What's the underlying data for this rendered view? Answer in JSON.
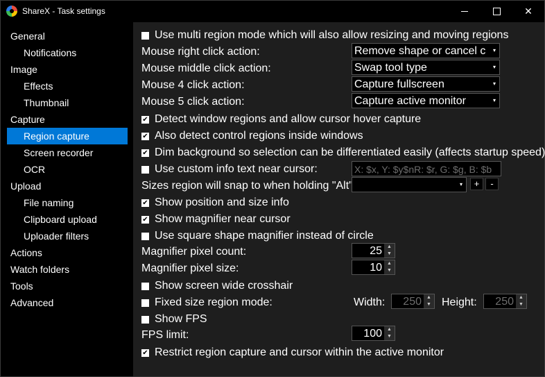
{
  "window": {
    "title": "ShareX - Task settings"
  },
  "sidebar": {
    "items": [
      {
        "label": "General"
      },
      {
        "label": "Notifications"
      },
      {
        "label": "Image"
      },
      {
        "label": "Effects"
      },
      {
        "label": "Thumbnail"
      },
      {
        "label": "Capture"
      },
      {
        "label": "Region capture"
      },
      {
        "label": "Screen recorder"
      },
      {
        "label": "OCR"
      },
      {
        "label": "Upload"
      },
      {
        "label": "File naming"
      },
      {
        "label": "Clipboard upload"
      },
      {
        "label": "Uploader filters"
      },
      {
        "label": "Actions"
      },
      {
        "label": "Watch folders"
      },
      {
        "label": "Tools"
      },
      {
        "label": "Advanced"
      }
    ],
    "selected": "Region capture"
  },
  "settings": {
    "multi_region": {
      "label": "Use multi region mode which will also allow resizing and moving regions",
      "checked": false
    },
    "right_click": {
      "label": "Mouse right click action:",
      "value": "Remove shape or cancel capture"
    },
    "middle_click": {
      "label": "Mouse middle click action:",
      "value": "Swap tool type"
    },
    "mouse4": {
      "label": "Mouse 4 click action:",
      "value": "Capture fullscreen"
    },
    "mouse5": {
      "label": "Mouse 5 click action:",
      "value": "Capture active monitor"
    },
    "detect_windows": {
      "label": "Detect window regions and allow cursor hover capture",
      "checked": true
    },
    "detect_controls": {
      "label": "Also detect control regions inside windows",
      "checked": true
    },
    "dim_background": {
      "label": "Dim background so selection can be differentiated easily (affects startup speed)",
      "checked": true
    },
    "custom_info": {
      "label": "Use custom info text near cursor:",
      "checked": false,
      "value": "X: $x, Y: $y$nR: $r, G: $g, B: $b"
    },
    "snap_sizes": {
      "label": "Sizes region will snap to when holding \"Alt\"",
      "value": "",
      "add": "+",
      "remove": "-"
    },
    "show_position": {
      "label": "Show position and size info",
      "checked": true
    },
    "show_magnifier": {
      "label": "Show magnifier near cursor",
      "checked": true
    },
    "square_magnifier": {
      "label": "Use square shape magnifier instead of circle",
      "checked": false
    },
    "mag_pixel_count": {
      "label": "Magnifier pixel count:",
      "value": "25"
    },
    "mag_pixel_size": {
      "label": "Magnifier pixel size:",
      "value": "10"
    },
    "crosshair": {
      "label": "Show screen wide crosshair",
      "checked": false
    },
    "fixed_size": {
      "label": "Fixed size region mode:",
      "checked": false,
      "width_label": "Width:",
      "width": "250",
      "height_label": "Height:",
      "height": "250"
    },
    "show_fps": {
      "label": "Show FPS",
      "checked": false
    },
    "fps_limit": {
      "label": "FPS limit:",
      "value": "100"
    },
    "restrict": {
      "label": "Restrict region capture and cursor within the active monitor",
      "checked": true
    }
  },
  "glyphs": {
    "check": "✔",
    "arrow_down": "▾",
    "spin_up": "▲",
    "spin_down": "▼",
    "close": "✕"
  }
}
